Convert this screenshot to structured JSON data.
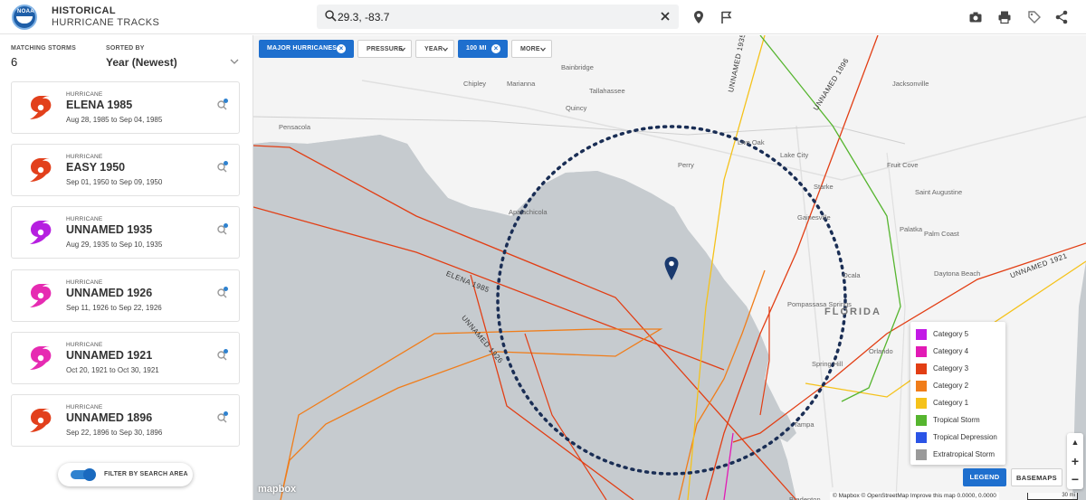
{
  "header": {
    "logo_text": "NOAA",
    "title_line1": "HISTORICAL",
    "title_line2": "HURRICANE TRACKS",
    "search_value": "29.3, -83.7",
    "icons": [
      "search-icon",
      "close-icon",
      "location-pin-icon",
      "flag-icon",
      "camera-icon",
      "print-icon",
      "tag-icon",
      "share-icon"
    ]
  },
  "sidebar": {
    "matching_label": "MATCHING STORMS",
    "matching_count": "6",
    "sorted_label": "SORTED BY",
    "sorted_value": "Year (Newest)",
    "storms": [
      {
        "type": "HURRICANE",
        "name": "ELENA 1985",
        "dates": "Aug 28, 1985 to Sep 04, 1985",
        "color": "#e2401c"
      },
      {
        "type": "HURRICANE",
        "name": "EASY 1950",
        "dates": "Sep 01, 1950 to Sep 09, 1950",
        "color": "#e2401c"
      },
      {
        "type": "HURRICANE",
        "name": "UNNAMED 1935",
        "dates": "Aug 29, 1935 to Sep 10, 1935",
        "color": "#b61fe0"
      },
      {
        "type": "HURRICANE",
        "name": "UNNAMED 1926",
        "dates": "Sep 11, 1926 to Sep 22, 1926",
        "color": "#e62bb2"
      },
      {
        "type": "HURRICANE",
        "name": "UNNAMED 1921",
        "dates": "Oct 20, 1921 to Oct 30, 1921",
        "color": "#e62bb2"
      },
      {
        "type": "HURRICANE",
        "name": "UNNAMED 1896",
        "dates": "Sep 22, 1896 to Sep 30, 1896",
        "color": "#e2401c"
      }
    ],
    "filter_label": "FILTER BY SEARCH AREA",
    "filter_on": true
  },
  "map": {
    "chips": [
      {
        "label": "MAJOR HURRICANES",
        "active": true,
        "removable": true
      },
      {
        "label": "PRESSURE",
        "active": false,
        "removable": false
      },
      {
        "label": "YEAR",
        "active": false,
        "removable": false
      },
      {
        "label": "100 MI",
        "active": true,
        "removable": true
      },
      {
        "label": "MORE",
        "active": false,
        "removable": false
      }
    ],
    "legend": [
      {
        "label": "Category 5",
        "color": "#c21ae6"
      },
      {
        "label": "Category 4",
        "color": "#e21ab5"
      },
      {
        "label": "Category 3",
        "color": "#e23e14"
      },
      {
        "label": "Category 2",
        "color": "#f07d1a"
      },
      {
        "label": "Category 1",
        "color": "#f5c21a"
      },
      {
        "label": "Tropical Storm",
        "color": "#56b52f"
      },
      {
        "label": "Tropical Depression",
        "color": "#2b54e6"
      },
      {
        "label": "Extratropical Storm",
        "color": "#9a9a9a"
      }
    ],
    "legend_button": "LEGEND",
    "basemaps_button": "BASEMAPS",
    "zoom_in": "+",
    "zoom_out": "−",
    "compass": "▲",
    "mapbox_logo": "mapbox",
    "attribution": "© Mapbox © OpenStreetMap  Improve this map   0.0000, 0.0000",
    "scale": "30 mi",
    "place_labels": {
      "florida": "FLORIDA",
      "cities": [
        "Bainbridge",
        "Chipley",
        "Marianna",
        "Tallahassee",
        "Quincy",
        "Jacksonville",
        "Gainesville",
        "Ocala",
        "Perry",
        "Live Oak",
        "Lake City",
        "Starke",
        "Palatka",
        "Daytona Beach",
        "Tampa",
        "Apalachicola",
        "Pensacola",
        "Spring Hill",
        "Fruit Cove",
        "Saint Augustine",
        "Palm Coast",
        "Pompassasa Springs",
        "Bradenton",
        "Orlando"
      ]
    },
    "track_labels": [
      "ELENA 1985",
      "UNNAMED 1926",
      "UNNAMED 1935",
      "UNNAMED 1896",
      "UNNAMED 1921"
    ],
    "search_center": "29.3, -83.7"
  }
}
